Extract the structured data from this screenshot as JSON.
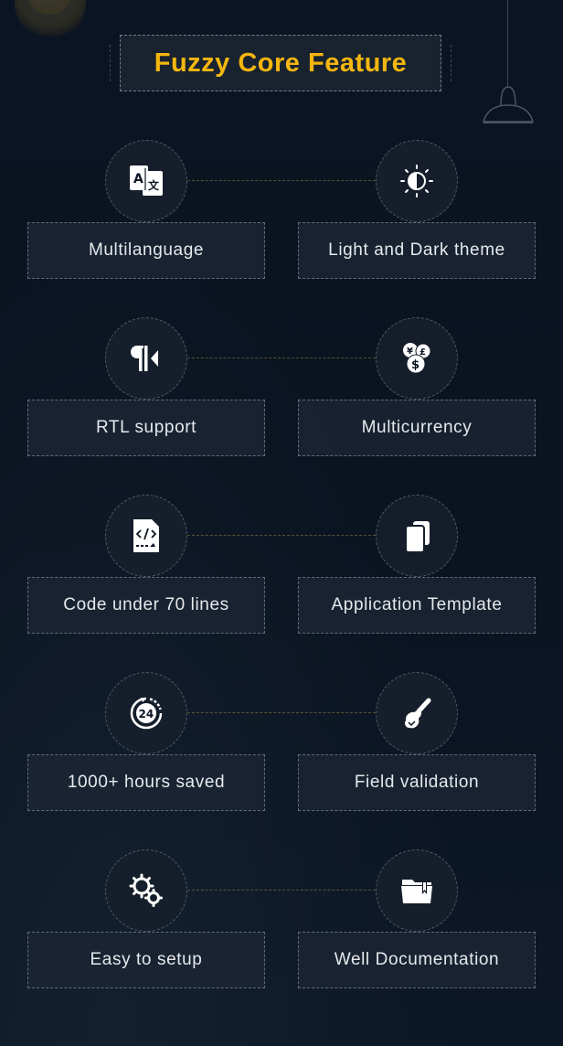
{
  "header": {
    "title": "Fuzzy Core Feature"
  },
  "colors": {
    "accent": "#f4b60f",
    "background": "#0b1422",
    "label_text": "#e6e9ec"
  },
  "features": [
    {
      "left": {
        "label": "Multilanguage",
        "icon": "translate-icon"
      },
      "right": {
        "label": "Light and Dark theme",
        "icon": "contrast-icon"
      }
    },
    {
      "left": {
        "label": "RTL support",
        "icon": "rtl-paragraph-icon"
      },
      "right": {
        "label": "Multicurrency",
        "icon": "currency-coins-icon"
      }
    },
    {
      "left": {
        "label": "Code under 70 lines",
        "icon": "code-file-icon"
      },
      "right": {
        "label": "Application Template",
        "icon": "copy-pages-icon"
      }
    },
    {
      "left": {
        "label": "1000+ hours saved",
        "icon": "clock-24-icon"
      },
      "right": {
        "label": "Field validation",
        "icon": "stamp-icon"
      }
    },
    {
      "left": {
        "label": "Easy to setup",
        "icon": "gears-icon"
      },
      "right": {
        "label": "Well Documentation",
        "icon": "folder-bookmark-icon"
      }
    }
  ]
}
